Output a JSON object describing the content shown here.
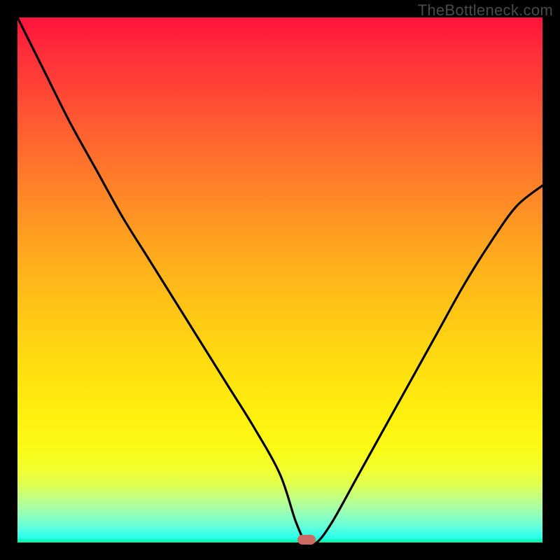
{
  "watermark": "TheBottleneck.com",
  "colors": {
    "frame_bg": "#000000",
    "marker": "#cd6a64",
    "curve": "#000000",
    "gradient_top": "#ff123c",
    "gradient_bottom": "#00f4a3"
  },
  "chart_data": {
    "type": "line",
    "title": "",
    "xlabel": "",
    "ylabel": "",
    "xlim": [
      0,
      100
    ],
    "ylim": [
      0,
      100
    ],
    "x": [
      0,
      5,
      10,
      15,
      20,
      25,
      30,
      35,
      40,
      45,
      50,
      53,
      55,
      57,
      60,
      65,
      70,
      75,
      80,
      85,
      90,
      95,
      100
    ],
    "values": [
      100,
      90,
      80,
      71,
      62,
      54,
      46,
      38,
      30,
      22,
      13,
      4,
      0,
      0,
      4,
      13,
      22,
      31,
      40,
      49,
      57,
      64,
      68
    ],
    "note": "V-shaped bottleneck curve; minimum (optimal match) between x≈53 and x≈57 where value≈0. Background gradient encodes value: red≈high bottleneck, green≈low.",
    "marker": {
      "x": 55,
      "y": 0,
      "meaning": "optimal / current selection"
    }
  }
}
